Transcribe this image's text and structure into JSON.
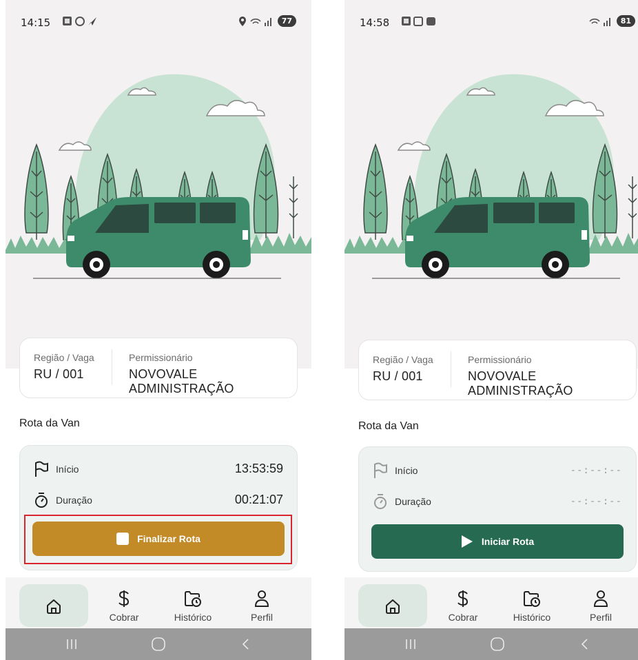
{
  "screens": [
    {
      "status": {
        "time": "14:15",
        "battery": "77"
      },
      "info": {
        "region_label": "Região / Vaga",
        "region_value": "RU / 001",
        "owner_label": "Permissionário",
        "owner_value": "NOVOVALE ADMINISTRAÇÃO"
      },
      "section_title": "Rota da Van",
      "route": {
        "start_label": "Início",
        "start_value": "13:53:59",
        "duration_label": "Duração",
        "duration_value": "00:21:07",
        "button_label": "Finalizar Rota"
      },
      "nav": {
        "charge": "Cobrar",
        "history": "Histórico",
        "profile": "Perfil"
      }
    },
    {
      "status": {
        "time": "14:58",
        "battery": "81"
      },
      "info": {
        "region_label": "Região / Vaga",
        "region_value": "RU / 001",
        "owner_label": "Permissionário",
        "owner_value": "NOVOVALE ADMINISTRAÇÃO"
      },
      "section_title": "Rota da Van",
      "route": {
        "start_label": "Início",
        "start_value": "--:--:--",
        "duration_label": "Duração",
        "duration_value": "--:--:--",
        "button_label": "Iniciar Rota"
      },
      "nav": {
        "charge": "Cobrar",
        "history": "Histórico",
        "profile": "Perfil"
      }
    }
  ],
  "colors": {
    "van": "#3d8b6b",
    "hill": "#c8e3d3",
    "tree": "#7bb897",
    "finish_button": "#c38b27",
    "start_button": "#276a52",
    "highlight_border": "#d9262e"
  },
  "icons": [
    "home-icon",
    "dollar-icon",
    "history-icon",
    "profile-icon",
    "flag-icon",
    "stopwatch-icon",
    "stop-icon",
    "play-icon"
  ]
}
